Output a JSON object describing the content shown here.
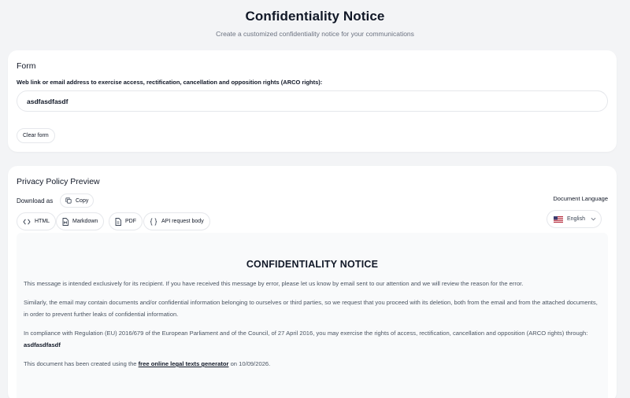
{
  "page": {
    "title": "Confidentiality Notice",
    "subtitle": "Create a customized confidentiality notice for your communications"
  },
  "form": {
    "title": "Form",
    "field_label": "Web link or email address to exercise access, rectification, cancellation and opposition rights (ARCO rights):",
    "field_value": "asdfasdfasdf",
    "clear_button": "Clear form"
  },
  "preview": {
    "title": "Privacy Policy Preview",
    "download_label": "Download as",
    "copy_button": "Copy",
    "formats": [
      {
        "label": "HTML",
        "icon": "code-icon"
      },
      {
        "label": "Markdown",
        "icon": "markdown-file-icon"
      },
      {
        "label": "PDF",
        "icon": "pdf-file-icon"
      },
      {
        "label": "API request body",
        "icon": "braces-icon"
      }
    ],
    "language": {
      "label": "Document Language",
      "selected": "English",
      "flag_icon": "us-flag-icon"
    }
  },
  "document": {
    "title": "CONFIDENTIALITY NOTICE",
    "p1": "This message is intended exclusively for its recipient. If you have received this message by error, please let us know by email sent to our attention and we will review the reason for the error.",
    "p2": "Similarly, the email may contain documents and/or confidential information belonging to ourselves or third parties, so we request that you proceed with its deletion, both from the email and from the attached documents, in order to prevent further leaks of confidential information.",
    "p3_text": "In compliance with Regulation (EU) 2016/679 of the European Parliament and of the Council, of 27 April 2016, you may exercise the rights of access, rectification, cancellation and opposition (ARCO rights) through:",
    "p3_value": "asdfasdfasdf",
    "p4_prefix": "This document has been created using the",
    "p4_link": "free online legal texts generator",
    "p4_suffix": "on 10/09/2026."
  },
  "colors": {
    "background": "#f3f4f6",
    "card": "#ffffff",
    "border": "#e5e7eb",
    "muted_text": "#6b7280",
    "doc_background": "#f9fafb"
  }
}
